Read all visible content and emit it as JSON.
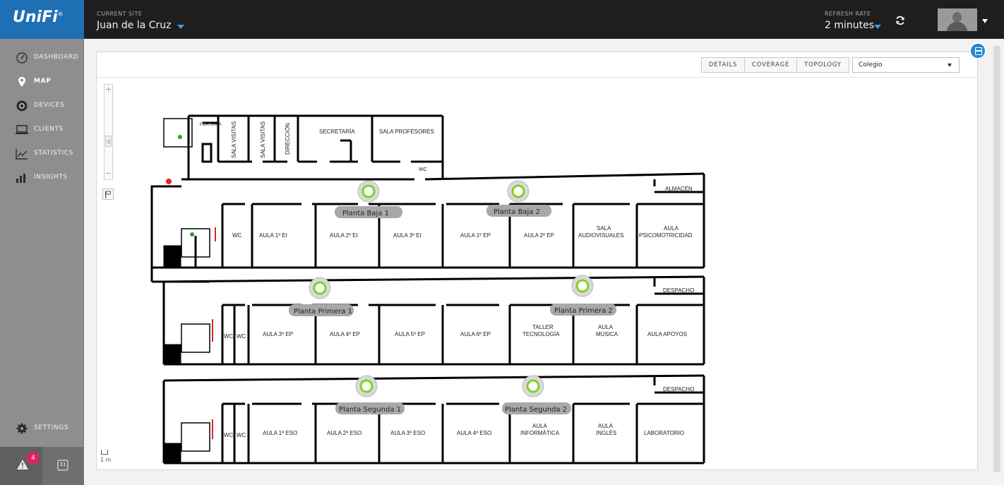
{
  "app": {
    "logo": "UniFi",
    "logo_mark": "®"
  },
  "topbar": {
    "site_label": "CURRENT SITE",
    "site_value": "Juan de la Cruz",
    "refresh_label": "REFRESH RATE",
    "refresh_value": "2 minutes",
    "refresh_icon": "refresh-icon",
    "avatar_icon": "user-avatar-icon"
  },
  "sidebar": {
    "items": [
      {
        "label": "DASHBOARD",
        "icon": "dashboard-icon",
        "active": false
      },
      {
        "label": "MAP",
        "icon": "map-pin-icon",
        "active": true
      },
      {
        "label": "DEVICES",
        "icon": "devices-icon",
        "active": false
      },
      {
        "label": "CLIENTS",
        "icon": "laptop-icon",
        "active": false
      },
      {
        "label": "STATISTICS",
        "icon": "statistics-icon",
        "active": false
      },
      {
        "label": "INSIGHTS",
        "icon": "insights-icon",
        "active": false
      }
    ],
    "settings": {
      "label": "SETTINGS",
      "icon": "gear-icon"
    },
    "alerts_count": "4",
    "calendar_day": "31"
  },
  "map_toolbar": {
    "tabs": [
      "DETAILS",
      "COVERAGE",
      "TOPOLOGY"
    ],
    "map_select_value": "Colegio"
  },
  "map": {
    "scale_label": "1 m",
    "zoom_plus": "+",
    "zoom_minus": "−",
    "floors": [
      {
        "rooms_top": [
          "PORTERÍA",
          "SALA VISITAS",
          "SALA VISITAS",
          "DIRECCIÓN",
          "SECRETARÍA",
          "SALA PROFESORES",
          "WC"
        ],
        "rooms": [
          "WC",
          "AULA 1º EI",
          "AULA 2º EI",
          "AULA 3º EI",
          "AULA 1º EP",
          "AULA 2º EP",
          "SALA",
          "AUDIOVISUALES",
          "AULA",
          "PSICOMOTRICIDAD"
        ],
        "corner_room": "ALMACÉN",
        "access_points": [
          "Planta Baja 1",
          "Planta Baja 2"
        ]
      },
      {
        "rooms": [
          "WC",
          "WC",
          "AULA 3º EP",
          "AULA 4º EP",
          "AULA 5º EP",
          "AULA 6º EP",
          "TALLER",
          "TECNOLOGÍA",
          "AULA",
          "MÚSICA",
          "AULA APOYOS"
        ],
        "corner_room": "DESPACHO",
        "access_points": [
          "Planta Primera 1",
          "Planta Primera 2"
        ]
      },
      {
        "rooms": [
          "WC",
          "WC",
          "AULA 1º ESO",
          "AULA 2º ESO",
          "AULA 3º ESO",
          "AULA 4º ESO",
          "AULA",
          "INFORMÁTICA",
          "AULA",
          "INGLÉS",
          "LABORATORIO"
        ],
        "corner_room": "DESPACHO",
        "access_points": [
          "Planta Segunda 1",
          "Planta Segunda 2"
        ]
      }
    ]
  },
  "colors": {
    "topbar": "#1e1e1e",
    "logo_bg": "#1e6fb3",
    "sidebar": "#8e8e8e",
    "accent": "#3d9be9",
    "ap_ring": "#7ed321",
    "alert_badge": "#e0245e"
  }
}
